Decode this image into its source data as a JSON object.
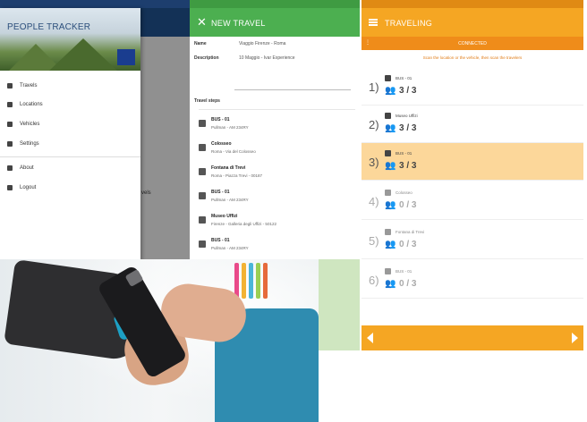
{
  "panel1": {
    "app_title": "PEOPLE TRACKER",
    "menu": [
      "Travels",
      "Locations",
      "Vehicles",
      "Settings",
      "About",
      "Logout"
    ],
    "background_text": "vels",
    "colors": {
      "appbar": "#1f4f8c",
      "status": "#1d3e6e"
    }
  },
  "panel2": {
    "title": "NEW TRAVEL",
    "close_icon": "close-icon",
    "name_label": "Name",
    "name_value": "Viaggio Firenze - Roma",
    "description_label": "Description",
    "description_value": "10 Maggio - Ivar Experience",
    "section_label": "Travel steps",
    "steps": [
      {
        "icon": "bus-icon",
        "title": "BUS - 01",
        "subtitle": "Pullman - AM 234RY"
      },
      {
        "icon": "museum-icon",
        "title": "Colosseo",
        "subtitle": "Roma - Via del Colosseo"
      },
      {
        "icon": "museum-icon",
        "title": "Fontana di Trevi",
        "subtitle": "Roma - Piazza Trevi - 00187"
      },
      {
        "icon": "bus-icon",
        "title": "BUS - 01",
        "subtitle": "Pullman - AM 234RY"
      },
      {
        "icon": "museum-icon",
        "title": "Museo Uffizi",
        "subtitle": "Firenze - Galleria degli Uffizi - 50122"
      },
      {
        "icon": "bus-icon",
        "title": "BUS - 01",
        "subtitle": "Pullman - AM 234RY"
      }
    ],
    "colors": {
      "appbar": "#4caf50"
    }
  },
  "panel3": {
    "title": "TRAVELING",
    "subbar_label": "CONNECTED",
    "instruction": "Scan the location or the vehicle, then scan the travelers",
    "rows": [
      {
        "num": "1)",
        "icon": "bus-icon",
        "place": "BUS - 01",
        "count": "3 / 3",
        "state": "done"
      },
      {
        "num": "2)",
        "icon": "museum-icon",
        "place": "Museo Uffizi",
        "count": "3 / 3",
        "state": "done"
      },
      {
        "num": "3)",
        "icon": "bus-icon",
        "place": "BUS - 01",
        "count": "3 / 3",
        "state": "active"
      },
      {
        "num": "4)",
        "icon": "museum-icon",
        "place": "Colosseo",
        "count": "0 / 3",
        "state": "pending"
      },
      {
        "num": "5)",
        "icon": "museum-icon",
        "place": "Fontana di Trevi",
        "count": "0 / 3",
        "state": "pending"
      },
      {
        "num": "6)",
        "icon": "bus-icon",
        "place": "BUS - 01",
        "count": "0 / 3",
        "state": "pending"
      }
    ],
    "colors": {
      "appbar": "#f5a623",
      "active_row": "#fcd79a"
    }
  }
}
